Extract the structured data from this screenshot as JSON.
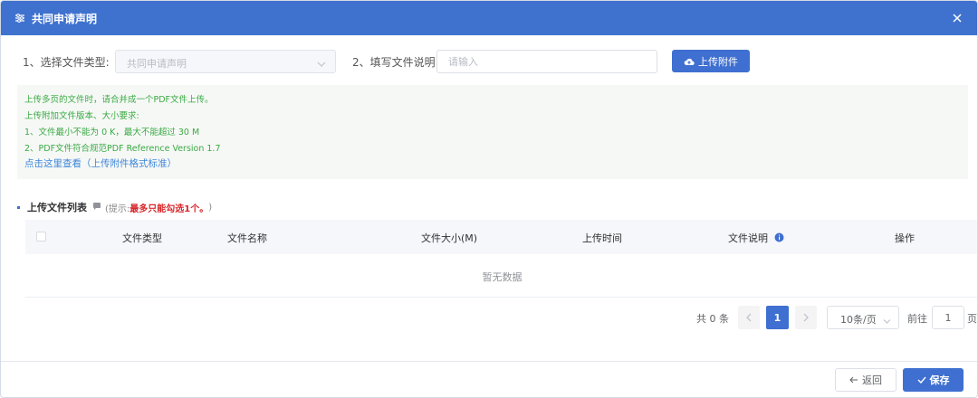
{
  "dialog": {
    "title": "共同申请声明",
    "icon": "sliders-icon",
    "close_icon": "close-icon"
  },
  "form": {
    "file_type_label": "1、选择文件类型:",
    "file_type_value": "共同申请声明",
    "description_label": "2、填写文件说明",
    "description_placeholder": "请输入",
    "upload_label": "上传附件"
  },
  "notice": {
    "lines": [
      "上传多页的文件时，请合并成一个PDF文件上传。",
      "上传附加文件版本、大小要求:",
      "1、文件最小不能为 0 K，最大不能超过 30 M",
      "2、PDF文件符合规范PDF Reference Version 1.7"
    ],
    "link": "点击这里查看（上传附件格式标准）"
  },
  "file_list": {
    "title": "上传文件列表",
    "hint_prefix": "(提示:",
    "hint_strong": "最多只能勾选1个。",
    "hint_suffix": ")",
    "columns": [
      "文件类型",
      "文件名称",
      "文件大小(M)",
      "上传时间",
      "文件说明",
      "操作"
    ],
    "empty_text": "暂无数据"
  },
  "pagination": {
    "total": "共 0 条",
    "current_page": "1",
    "page_size": "10条/页",
    "goto_label": "前往",
    "goto_value": "1",
    "page_suffix": "页"
  },
  "footer": {
    "back_label": "返回",
    "save_label": "保存"
  },
  "colors": {
    "header": "#3f72cf",
    "primary": "#3f6fd0",
    "notice_text": "#3aaa43",
    "link": "#3d86d9",
    "hint_strong": "#d7262a"
  }
}
